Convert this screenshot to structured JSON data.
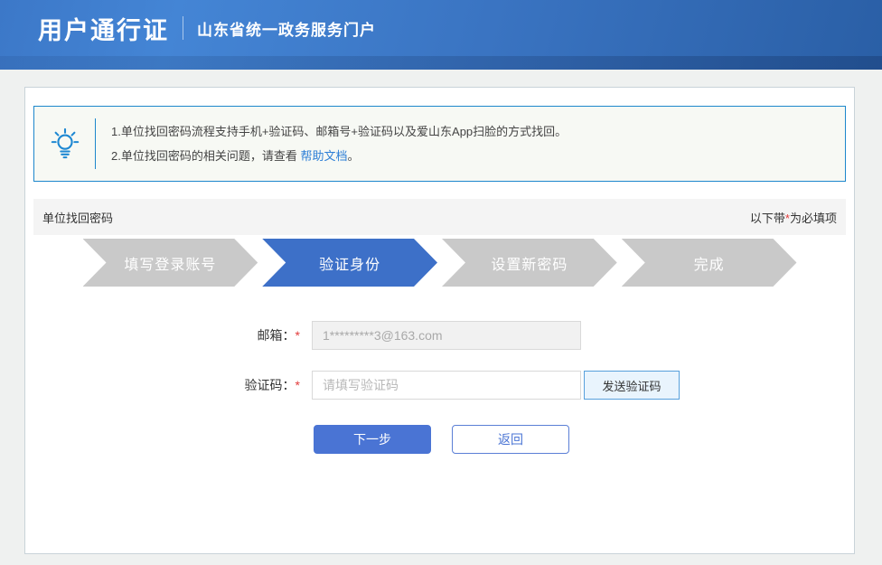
{
  "header": {
    "brand": "用户通行证",
    "portal": "山东省统一政务服务门户"
  },
  "notice": {
    "line1": "1.单位找回密码流程支持手机+验证码、邮箱号+验证码以及爱山东App扫脸的方式找回。",
    "line2_prefix": "2.单位找回密码的相关问题，请查看 ",
    "line2_link": "帮助文档",
    "line2_suffix": "。"
  },
  "section": {
    "title": "单位找回密码",
    "required_prefix": "以下带",
    "required_star": "*",
    "required_suffix": "为必填项"
  },
  "steps": [
    {
      "label": "填写登录账号",
      "active": false
    },
    {
      "label": "验证身份",
      "active": true
    },
    {
      "label": "设置新密码",
      "active": false
    },
    {
      "label": "完成",
      "active": false
    }
  ],
  "form": {
    "email_label": "邮箱：",
    "required_mark": "*",
    "email_value": "1*********3@163.com",
    "code_label": "验证码：",
    "code_placeholder": "请填写验证码",
    "send_code_button": "发送验证码",
    "next_button": "下一步",
    "back_button": "返回"
  },
  "colors": {
    "header_blue": "#3a74c2",
    "notice_border_blue": "#1d87cc",
    "link_blue": "#2e7fd6",
    "active_step_blue": "#3d70c8",
    "primary_button_blue": "#4a74d4",
    "required_red": "#e23c3c",
    "inactive_step_gray": "#c9c9c9"
  }
}
